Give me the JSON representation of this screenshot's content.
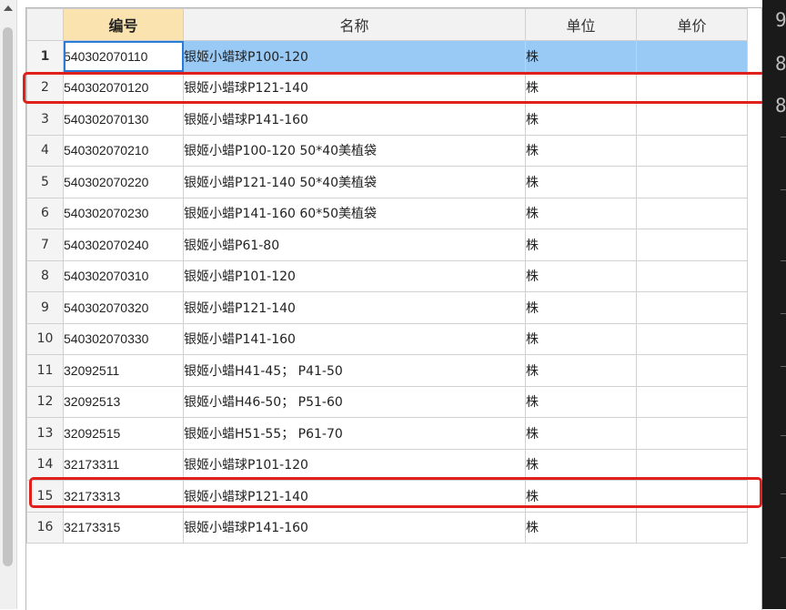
{
  "columns": {
    "code": "编号",
    "name": "名称",
    "unit": "单位",
    "price": "单价"
  },
  "rows": [
    {
      "no": "1",
      "code": "540302070110",
      "name": "银姬小蜡球P100-120",
      "unit": "株",
      "price": ""
    },
    {
      "no": "2",
      "code": "540302070120",
      "name": "银姬小蜡球P121-140",
      "unit": "株",
      "price": ""
    },
    {
      "no": "3",
      "code": "540302070130",
      "name": "银姬小蜡球P141-160",
      "unit": "株",
      "price": ""
    },
    {
      "no": "4",
      "code": "540302070210",
      "name": "银姬小蜡P100-120 50*40美植袋",
      "unit": "株",
      "price": ""
    },
    {
      "no": "5",
      "code": "540302070220",
      "name": "银姬小蜡P121-140 50*40美植袋",
      "unit": "株",
      "price": ""
    },
    {
      "no": "6",
      "code": "540302070230",
      "name": "银姬小蜡P141-160 60*50美植袋",
      "unit": "株",
      "price": ""
    },
    {
      "no": "7",
      "code": "540302070240",
      "name": "银姬小蜡P61-80",
      "unit": "株",
      "price": ""
    },
    {
      "no": "8",
      "code": "540302070310",
      "name": "银姬小蜡P101-120",
      "unit": "株",
      "price": ""
    },
    {
      "no": "9",
      "code": "540302070320",
      "name": "银姬小蜡P121-140",
      "unit": "株",
      "price": ""
    },
    {
      "no": "10",
      "code": "540302070330",
      "name": "银姬小蜡P141-160",
      "unit": "株",
      "price": ""
    },
    {
      "no": "11",
      "code": "32092511",
      "name": "银姬小蜡H41-45； P41-50",
      "unit": "株",
      "price": ""
    },
    {
      "no": "12",
      "code": "32092513",
      "name": "银姬小蜡H46-50； P51-60",
      "unit": "株",
      "price": ""
    },
    {
      "no": "13",
      "code": "32092515",
      "name": "银姬小蜡H51-55； P61-70",
      "unit": "株",
      "price": ""
    },
    {
      "no": "14",
      "code": "32173311",
      "name": "银姬小蜡球P101-120",
      "unit": "株",
      "price": ""
    },
    {
      "no": "15",
      "code": "32173313",
      "name": "银姬小蜡球P121-140",
      "unit": "株",
      "price": ""
    },
    {
      "no": "16",
      "code": "32173315",
      "name": "银姬小蜡球P141-160",
      "unit": "株",
      "price": ""
    }
  ],
  "selected_row": "1",
  "highlighted_rows": [
    "2",
    "15"
  ],
  "colors": {
    "selection": "#99c9f5",
    "header_highlight": "#fbe3b0",
    "annotation": "#e0201c"
  },
  "right_edge_glyphs": [
    "9",
    "8",
    "8"
  ]
}
